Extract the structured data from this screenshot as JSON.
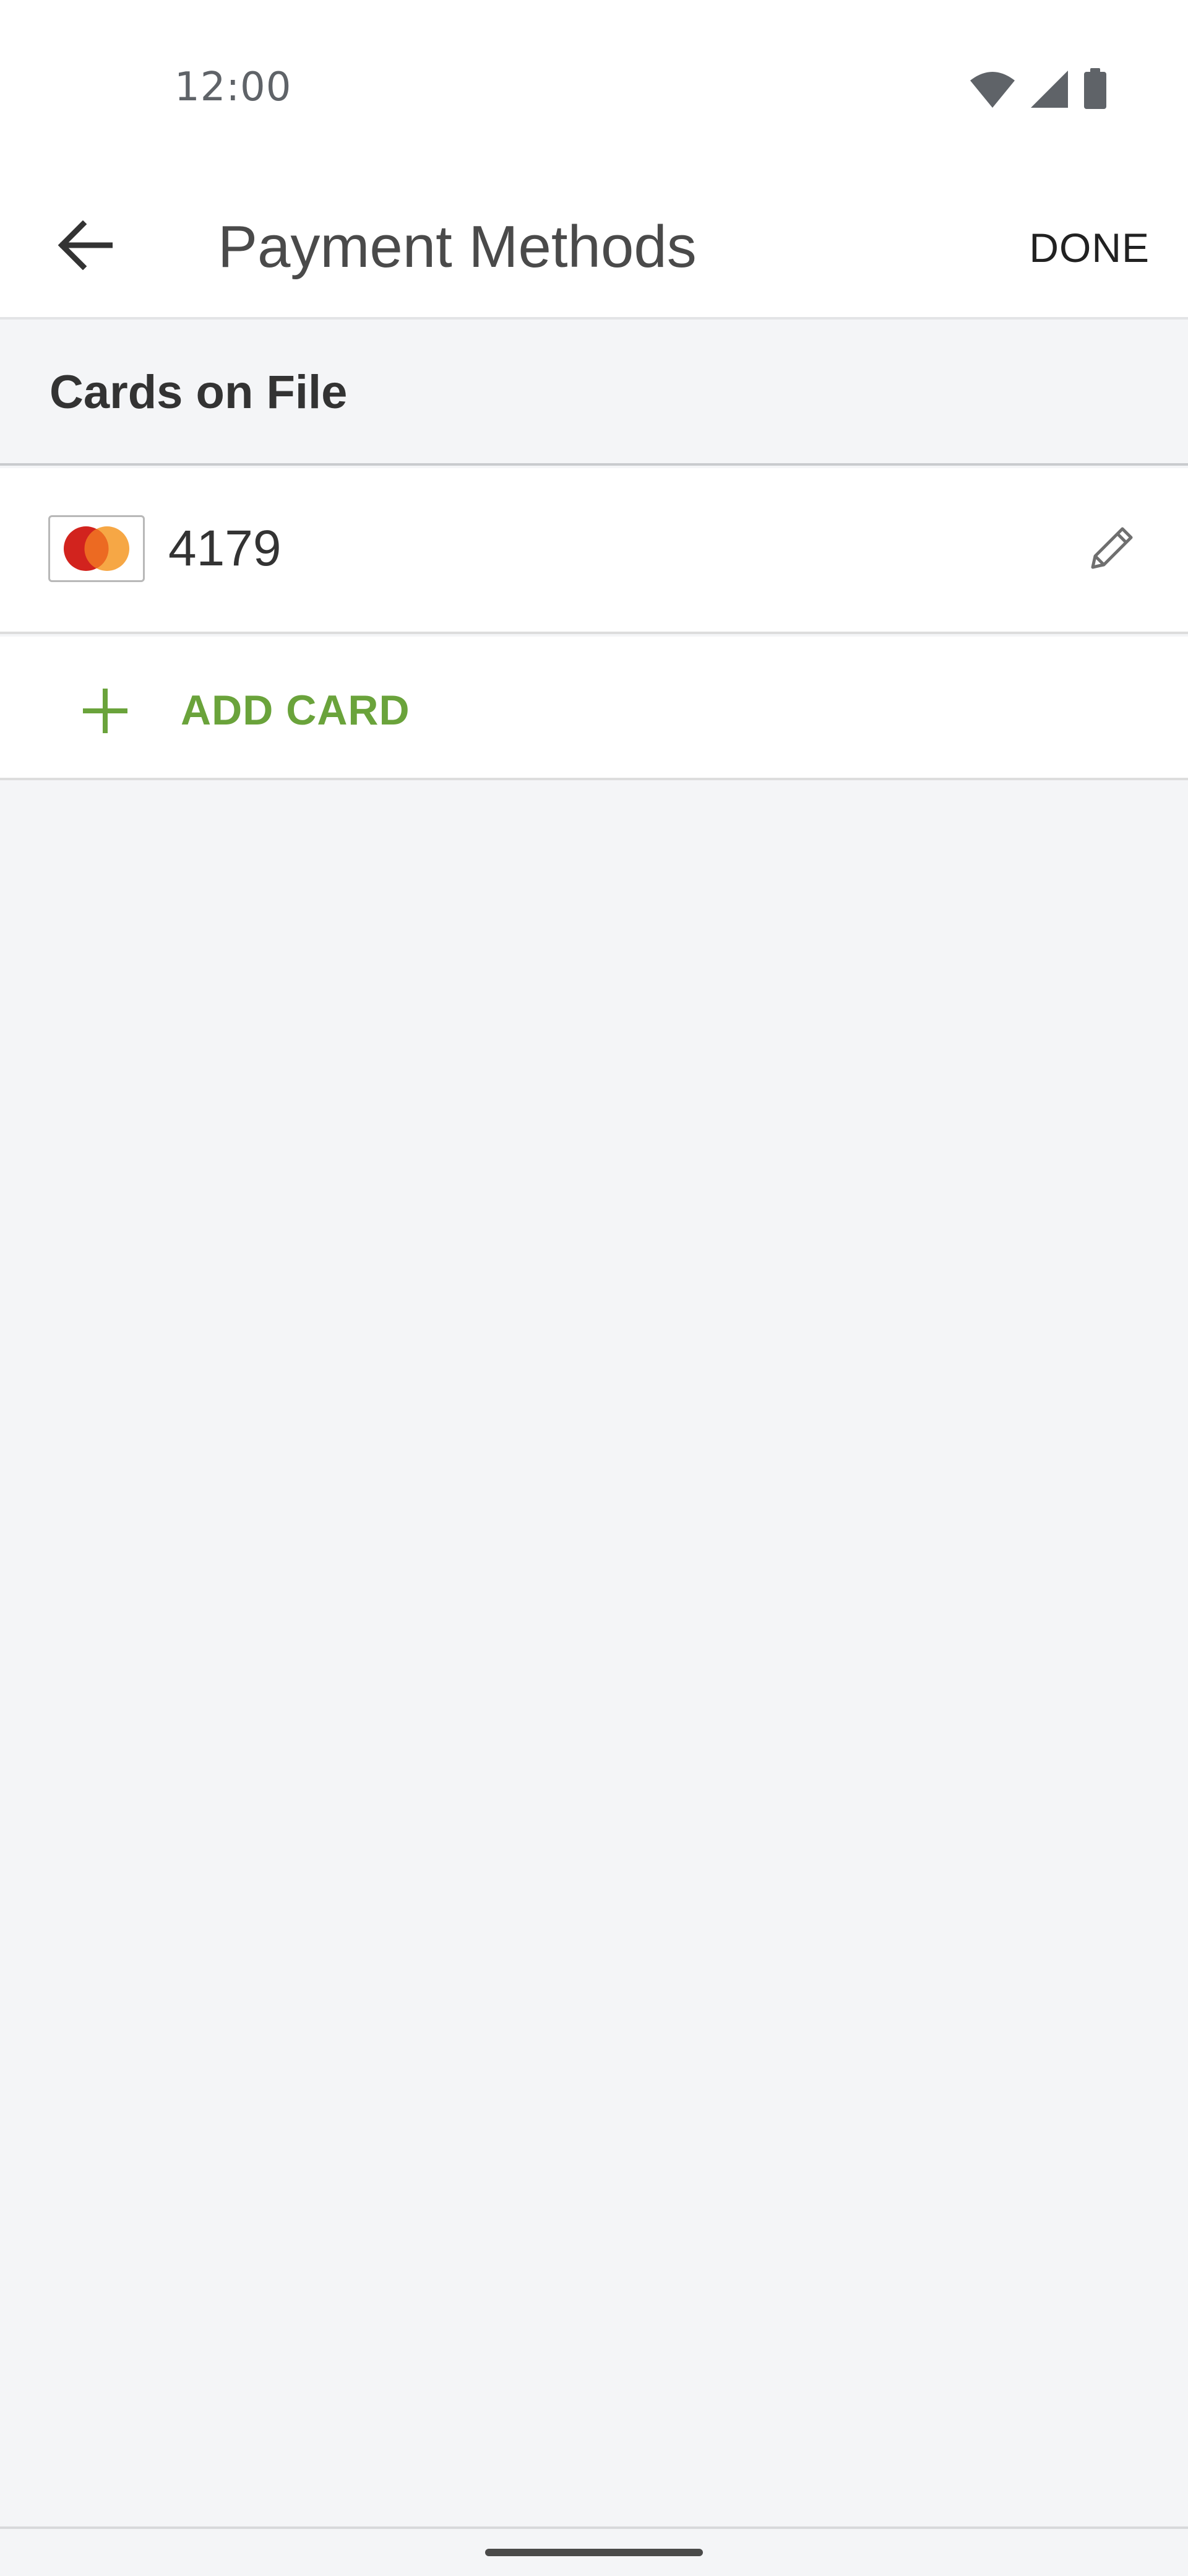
{
  "status_bar": {
    "time": "12:00",
    "icons": [
      "wifi-icon",
      "cellular-signal-icon",
      "battery-icon"
    ]
  },
  "app_bar": {
    "back_icon": "arrow-left-icon",
    "title": "Payment Methods",
    "done_label": "DONE"
  },
  "section": {
    "title": "Cards on File"
  },
  "cards": [
    {
      "brand_icon": "mastercard-logo",
      "last_four": "4179",
      "edit_icon": "pencil-icon"
    }
  ],
  "add_card": {
    "icon": "plus-icon",
    "label": "ADD CARD"
  },
  "colors": {
    "accent_green": "#6aa33b",
    "background": "#f4f5f7",
    "surface": "#ffffff",
    "mastercard_red": "#d2231e",
    "mastercard_orange": "#f5a23b"
  }
}
